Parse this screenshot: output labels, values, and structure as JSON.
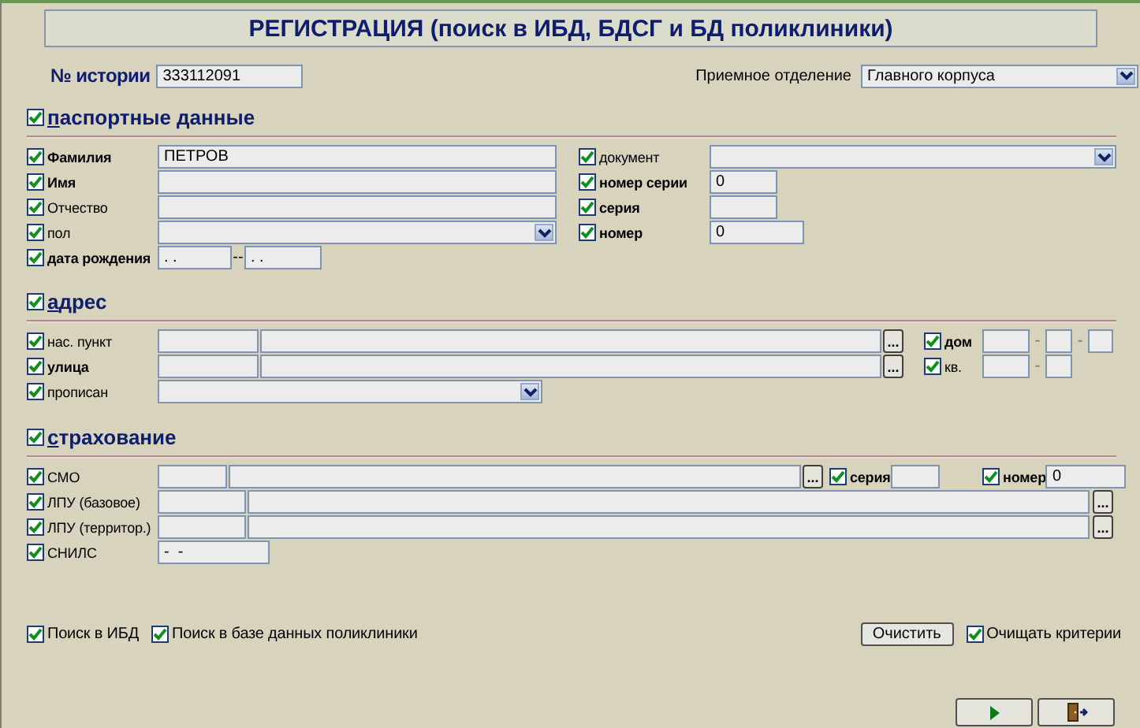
{
  "title": "РЕГИСТРАЦИЯ (поиск в ИБД, БДСГ и БД поликлиники)",
  "history": {
    "label": "№ истории",
    "value": "333112091"
  },
  "department": {
    "label": "Приемное отделение",
    "value": "Главного корпуса"
  },
  "passport": {
    "header": {
      "label": "паспортные данные",
      "checked": true
    },
    "left": [
      {
        "label": "Фамилия",
        "checked": true,
        "required": true,
        "fields": [
          {
            "kind": "text",
            "value": "ПЕТРОВ"
          }
        ]
      },
      {
        "label": "Имя",
        "checked": true,
        "required": true,
        "fields": [
          {
            "kind": "text"
          }
        ]
      },
      {
        "label": "Отчество",
        "checked": true,
        "required": false,
        "fields": [
          {
            "kind": "text"
          }
        ]
      },
      {
        "label": "пол",
        "checked": true,
        "required": false,
        "fields": [
          {
            "kind": "select"
          }
        ]
      },
      {
        "label": "дата рождения",
        "checked": true,
        "required": true,
        "fields": [
          {
            "kind": "text",
            "value": ". ."
          },
          {
            "kind": "sep",
            "text": "--",
            "faint": false
          },
          {
            "kind": "text",
            "value": ". ."
          }
        ]
      }
    ],
    "right": [
      {
        "label": "документ",
        "checked": true,
        "required": false,
        "fields": [
          {
            "kind": "select"
          }
        ]
      },
      {
        "label": "номер серии",
        "checked": true,
        "required": true,
        "fields": [
          {
            "kind": "text",
            "value": "0"
          }
        ]
      },
      {
        "label": "серия",
        "checked": true,
        "required": true,
        "fields": [
          {
            "kind": "text"
          }
        ]
      },
      {
        "label": "номер",
        "checked": true,
        "required": true,
        "fields": [
          {
            "kind": "text",
            "value": "0"
          }
        ]
      }
    ]
  },
  "address": {
    "header": {
      "label": "адрес",
      "checked": true
    },
    "rows": [
      {
        "label": "нас. пункт",
        "checked": true,
        "required": false,
        "fields": [
          {
            "kind": "text"
          },
          {
            "kind": "text"
          },
          {
            "kind": "browse",
            "text": "..."
          },
          {
            "kind": "check",
            "label": "дом",
            "checked": true,
            "required": true
          },
          {
            "kind": "text"
          },
          {
            "kind": "sep",
            "text": "-",
            "faint": true
          },
          {
            "kind": "text"
          },
          {
            "kind": "sep",
            "text": "-",
            "faint": true
          },
          {
            "kind": "text"
          }
        ]
      },
      {
        "label": "улица",
        "checked": true,
        "required": true,
        "fields": [
          {
            "kind": "text"
          },
          {
            "kind": "text"
          },
          {
            "kind": "browse",
            "text": "..."
          },
          {
            "kind": "check",
            "label": "кв.",
            "checked": true,
            "required": false
          },
          {
            "kind": "text"
          },
          {
            "kind": "sep",
            "text": "-",
            "faint": true
          },
          {
            "kind": "text"
          }
        ]
      },
      {
        "label": "прописан",
        "checked": true,
        "required": false,
        "fields": [
          {
            "kind": "select"
          }
        ]
      }
    ]
  },
  "insurance": {
    "header": {
      "label": "страхование",
      "checked": true
    },
    "rows": [
      {
        "label": "СМО",
        "checked": true,
        "required": false,
        "fields": [
          {
            "kind": "text"
          },
          {
            "kind": "text"
          },
          {
            "kind": "browse",
            "text": "..."
          },
          {
            "kind": "check",
            "label": "серия",
            "checked": true,
            "required": true
          },
          {
            "kind": "text"
          },
          {
            "kind": "check",
            "label": "номер",
            "checked": true,
            "required": true
          },
          {
            "kind": "text",
            "value": "0"
          }
        ]
      },
      {
        "label": "ЛПУ (базовое)",
        "checked": true,
        "required": false,
        "fields": [
          {
            "kind": "text"
          },
          {
            "kind": "text"
          },
          {
            "kind": "browse",
            "text": "..."
          }
        ]
      },
      {
        "label": "ЛПУ (территор.)",
        "checked": true,
        "required": false,
        "fields": [
          {
            "kind": "text"
          },
          {
            "kind": "text"
          },
          {
            "kind": "browse",
            "text": "..."
          }
        ]
      },
      {
        "label": "СНИЛС",
        "checked": true,
        "required": false,
        "fields": [
          {
            "kind": "text",
            "value": "-  -"
          }
        ]
      }
    ]
  },
  "options": [
    {
      "label": "Поиск в ИБД",
      "checked": true
    },
    {
      "label": "Поиск в базе данных поликлиники",
      "checked": true
    }
  ],
  "clear_button": "Очистить",
  "clear_criteria": {
    "label": "Очищать критерии",
    "checked": true
  },
  "nav_buttons": [
    {
      "kind": "next"
    },
    {
      "kind": "exit"
    }
  ]
}
